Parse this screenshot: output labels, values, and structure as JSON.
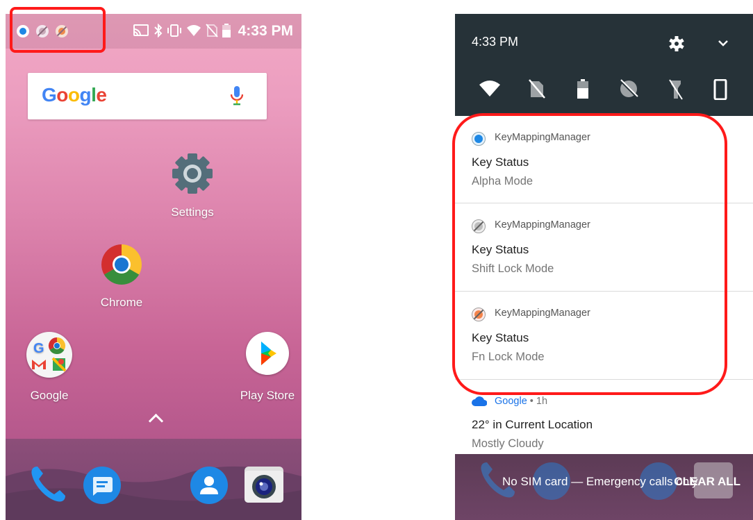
{
  "home": {
    "status_time": "4:33 PM",
    "search_logo": [
      "G",
      "o",
      "o",
      "g",
      "l",
      "e"
    ],
    "search_logo_colors": [
      "#4285F4",
      "#EA4335",
      "#FBBC05",
      "#4285F4",
      "#34A853",
      "#EA4335"
    ],
    "apps": [
      {
        "id": "settings",
        "label": "Settings"
      },
      {
        "id": "chrome",
        "label": "Chrome"
      },
      {
        "id": "google",
        "label": "Google"
      },
      {
        "id": "play-store",
        "label": "Play Store"
      }
    ],
    "status_icons_left": [
      "alpha-mode-icon",
      "shift-lock-icon",
      "fn-lock-icon"
    ],
    "status_icons_right": [
      "cast-icon",
      "bluetooth-icon",
      "vibrate-icon",
      "wifi-icon",
      "no-sim-icon",
      "battery-icon"
    ],
    "dock": [
      "phone-icon",
      "messages-icon",
      "contacts-icon",
      "camera-icon"
    ]
  },
  "shade": {
    "time": "4:33 PM",
    "quick_tiles": [
      "wifi-icon",
      "no-sim-icon",
      "battery-icon",
      "do-not-disturb-icon",
      "flashlight-off-icon",
      "rotation-icon"
    ],
    "notifications": [
      {
        "app": "KeyMappingManager",
        "title": "Key Status",
        "text": "Alpha Mode",
        "icon": "alpha-mode-icon"
      },
      {
        "app": "KeyMappingManager",
        "title": "Key Status",
        "text": "Shift Lock Mode",
        "icon": "shift-lock-icon"
      },
      {
        "app": "KeyMappingManager",
        "title": "Key Status",
        "text": "Fn Lock Mode",
        "icon": "fn-lock-icon"
      }
    ],
    "weather": {
      "app": "Google",
      "age": " • 1h",
      "title": "22° in Current Location",
      "text": "Mostly Cloudy"
    },
    "lock_message": "No SIM card — Emergency calls only",
    "clear_all": "CLEAR ALL"
  },
  "colors": {
    "highlight": "#ff1a1a",
    "shade_bg": "#263238",
    "google_blue": "#1a73e8"
  }
}
